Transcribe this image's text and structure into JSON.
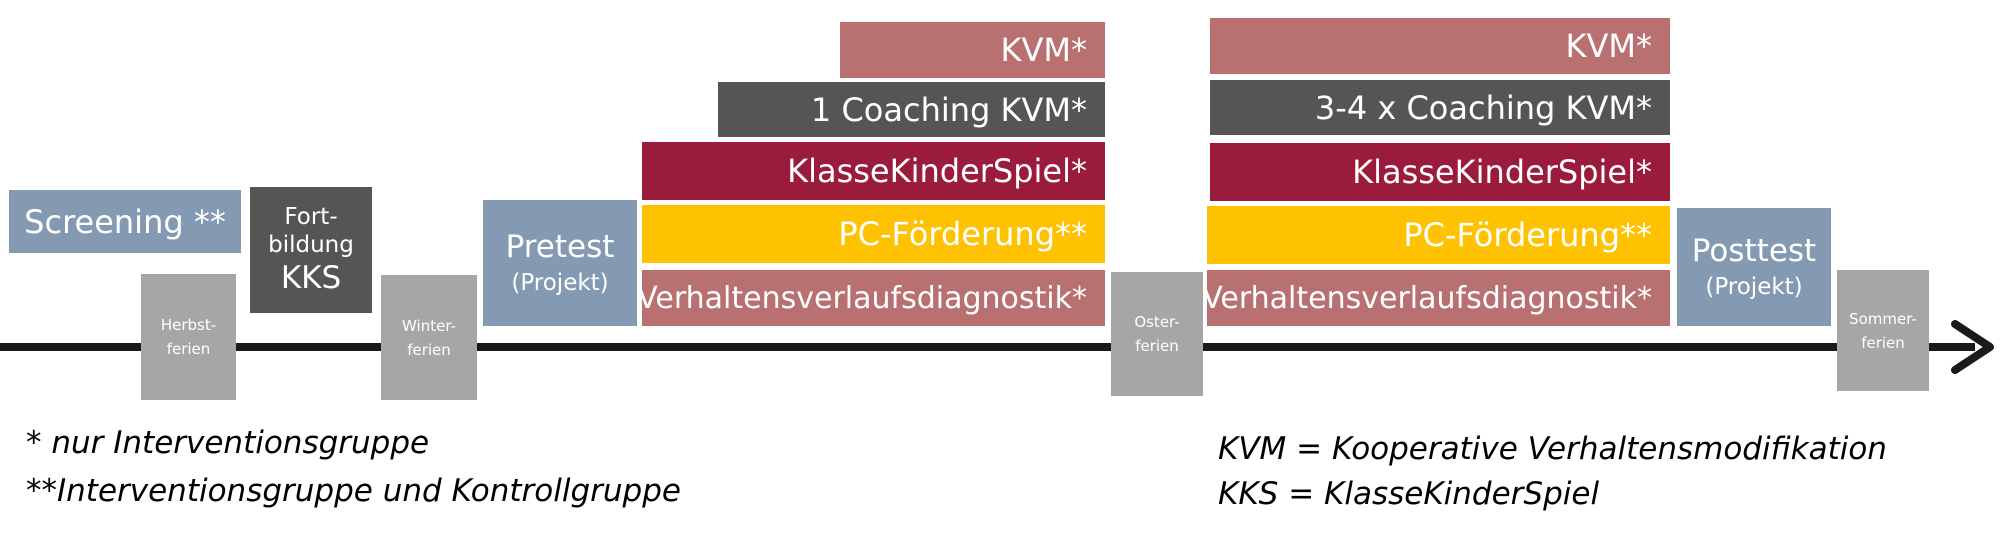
{
  "screening": "Screening **",
  "fortbildung": {
    "line1": "Fort-",
    "line2": "bildung",
    "line3": "KKS"
  },
  "pretest": {
    "title": "Pretest",
    "sub": "(Projekt)"
  },
  "posttest": {
    "title": "Posttest",
    "sub": "(Projekt)"
  },
  "holidays": {
    "herbst": {
      "line1": "Herbst-",
      "line2": "ferien"
    },
    "winter": {
      "line1": "Winter-",
      "line2": "ferien"
    },
    "oster": {
      "line1": "Oster-",
      "line2": "ferien"
    },
    "sommer": {
      "line1": "Sommer-",
      "line2": "ferien"
    }
  },
  "phase1": {
    "kvm": "KVM*",
    "coaching": "1 Coaching KVM*",
    "kks": "KlasseKinderSpiel*",
    "pc": "PC-Förderung**",
    "vvd": "Verhaltensverlaufsdiagnostik*"
  },
  "phase2": {
    "kvm": "KVM*",
    "coaching": "3-4 x Coaching KVM*",
    "kks": "KlasseKinderSpiel*",
    "pc": "PC-Förderung**",
    "vvd": "Verhaltensverlaufsdiagnostik*"
  },
  "legend": {
    "note1": "* nur Interventionsgruppe",
    "note2": "**Interventionsgruppe und Kontrollgruppe",
    "note3": "KVM = Kooperative Verhaltensmodifikation",
    "note4": "KKS = KlasseKinderSpiel"
  },
  "colors": {
    "kvm": "#b87071",
    "coaching": "#555555",
    "kks": "#9b1b3c",
    "pc": "#fec200",
    "test": "#8499b2",
    "holiday": "#a6a6a6"
  }
}
